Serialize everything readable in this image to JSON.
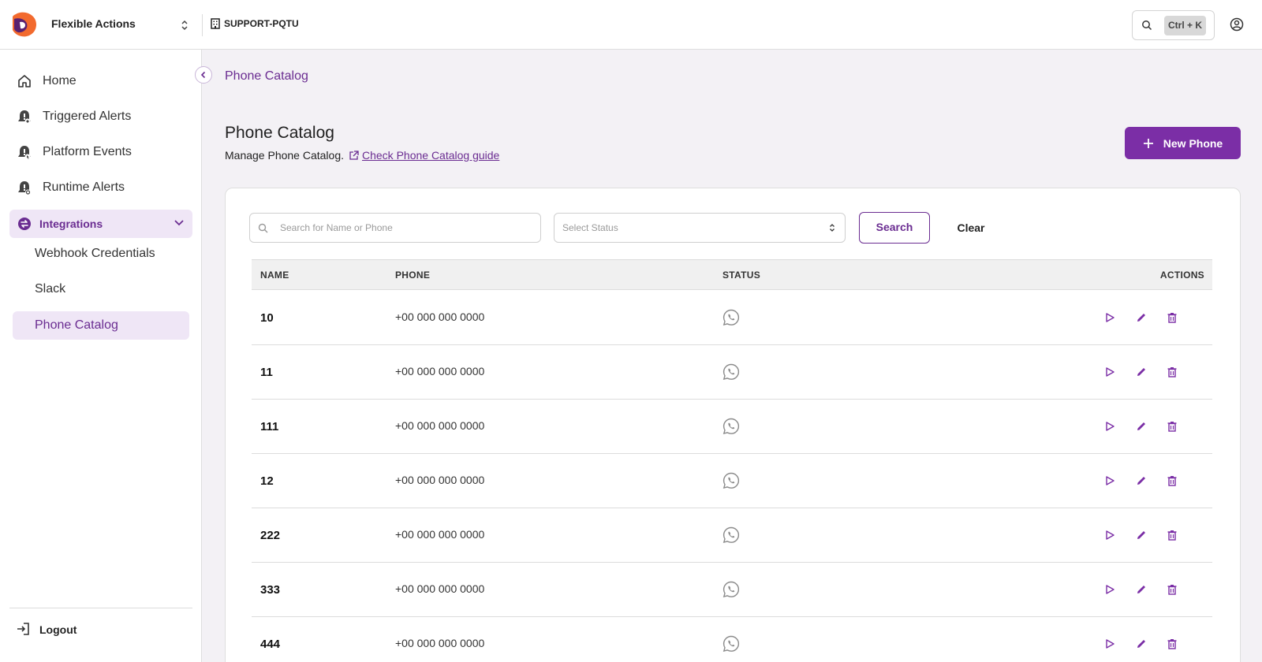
{
  "app": {
    "name": "Flexible Actions",
    "org": "SUPPORT-PQTU",
    "shortcut": "Ctrl + K"
  },
  "colors": {
    "accent": "#7b2ea6",
    "accent_light": "#efe6f6",
    "logo_orange": "#f26a2e"
  },
  "sidebar": {
    "items": [
      {
        "label": "Home",
        "icon": "home-icon"
      },
      {
        "label": "Triggered Alerts",
        "icon": "alert-bell-icon"
      },
      {
        "label": "Platform Events",
        "icon": "event-bell-icon"
      },
      {
        "label": "Runtime Alerts",
        "icon": "runtime-bell-icon"
      }
    ],
    "integrations": {
      "label": "Integrations",
      "expanded": true,
      "children": [
        {
          "label": "Webhook Credentials",
          "active": false
        },
        {
          "label": "Slack",
          "active": false
        },
        {
          "label": "Phone Catalog",
          "active": true
        }
      ]
    },
    "logout": "Logout"
  },
  "page": {
    "breadcrumb": "Phone Catalog",
    "title": "Phone Catalog",
    "subtitle": "Manage Phone Catalog.",
    "guide_link": "Check Phone Catalog guide",
    "new_button": "New Phone"
  },
  "filters": {
    "search_placeholder": "Search for Name or Phone",
    "status_placeholder": "Select Status",
    "search_button": "Search",
    "clear_button": "Clear"
  },
  "table": {
    "columns": [
      "NAME",
      "PHONE",
      "STATUS",
      "ACTIONS"
    ],
    "rows": [
      {
        "name": "10",
        "phone": "+00 000 000 0000",
        "status_icon": "whatsapp-icon"
      },
      {
        "name": "11",
        "phone": "+00 000 000 0000",
        "status_icon": "whatsapp-icon"
      },
      {
        "name": "111",
        "phone": "+00 000 000 0000",
        "status_icon": "whatsapp-icon"
      },
      {
        "name": "12",
        "phone": "+00 000 000 0000",
        "status_icon": "whatsapp-icon"
      },
      {
        "name": "222",
        "phone": "+00 000 000 0000",
        "status_icon": "whatsapp-icon"
      },
      {
        "name": "333",
        "phone": "+00 000 000 0000",
        "status_icon": "whatsapp-icon"
      },
      {
        "name": "444",
        "phone": "+00 000 000 0000",
        "status_icon": "whatsapp-icon"
      }
    ],
    "row_actions": [
      "send-icon",
      "edit-icon",
      "delete-icon"
    ]
  }
}
